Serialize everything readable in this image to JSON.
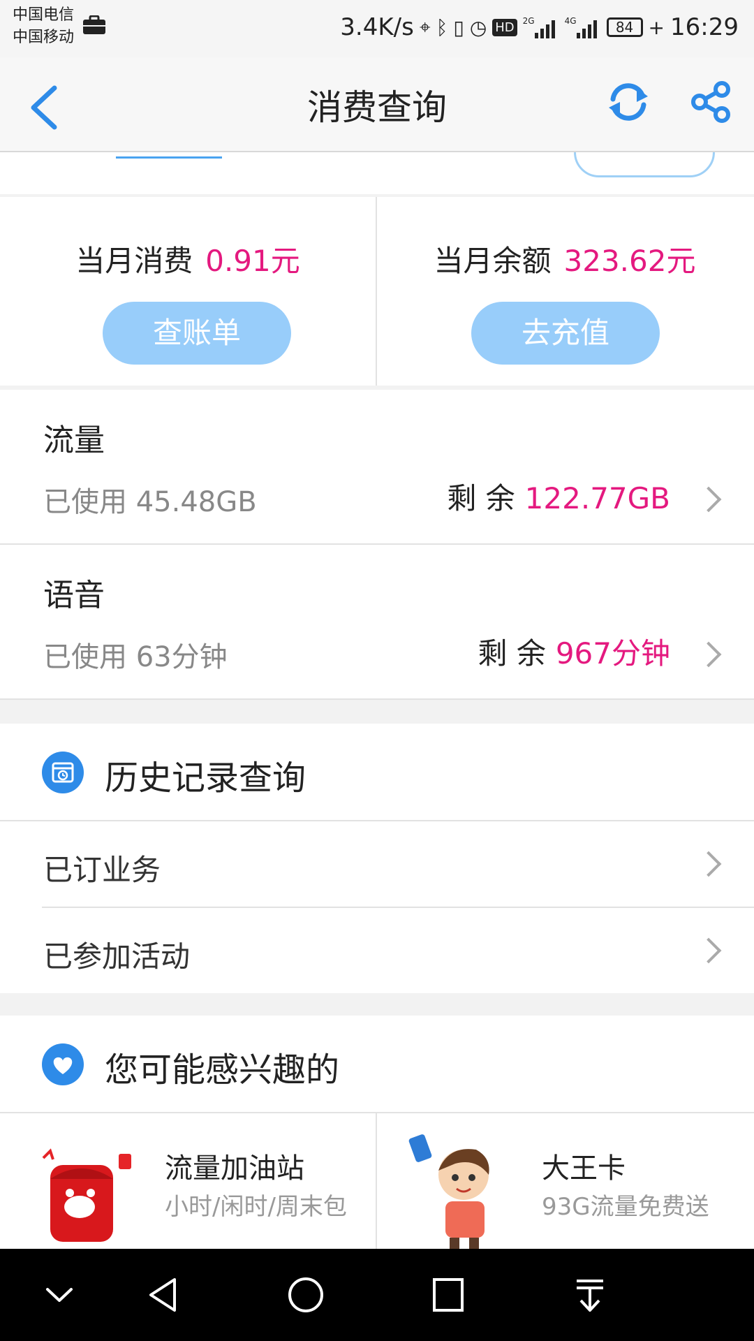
{
  "status_bar": {
    "carrier1": "中国电信",
    "carrier2": "中国移动",
    "speed": "3.4K/s",
    "net2": "2G",
    "net4": "4G",
    "battery": "84",
    "time": "16:29"
  },
  "nav": {
    "title": "消费查询"
  },
  "summary": {
    "spent_label": "当月消费",
    "spent_value": "0.91元",
    "balance_label": "当月余额",
    "balance_value": "323.62元",
    "bill_button": "查账单",
    "recharge_button": "去充值"
  },
  "data_usage": {
    "title": "流量",
    "used": "已使用 45.48GB",
    "remain_label": "剩 余",
    "remain_value": "122.77GB"
  },
  "voice_usage": {
    "title": "语音",
    "used": "已使用 63分钟",
    "remain_label": "剩 余",
    "remain_value": "967分钟"
  },
  "history": {
    "title": "历史记录查询",
    "rows": [
      "已订业务",
      "已参加活动"
    ]
  },
  "interest": {
    "title": "您可能感兴趣的",
    "cards": [
      {
        "title": "流量加油站",
        "subtitle": "小时/闲时/周末包"
      },
      {
        "title": "大王卡",
        "subtitle": "93G流量免费送"
      }
    ]
  },
  "colors": {
    "accent": "#2e8be8",
    "highlight": "#e4197f",
    "pill": "#98cdfa"
  }
}
